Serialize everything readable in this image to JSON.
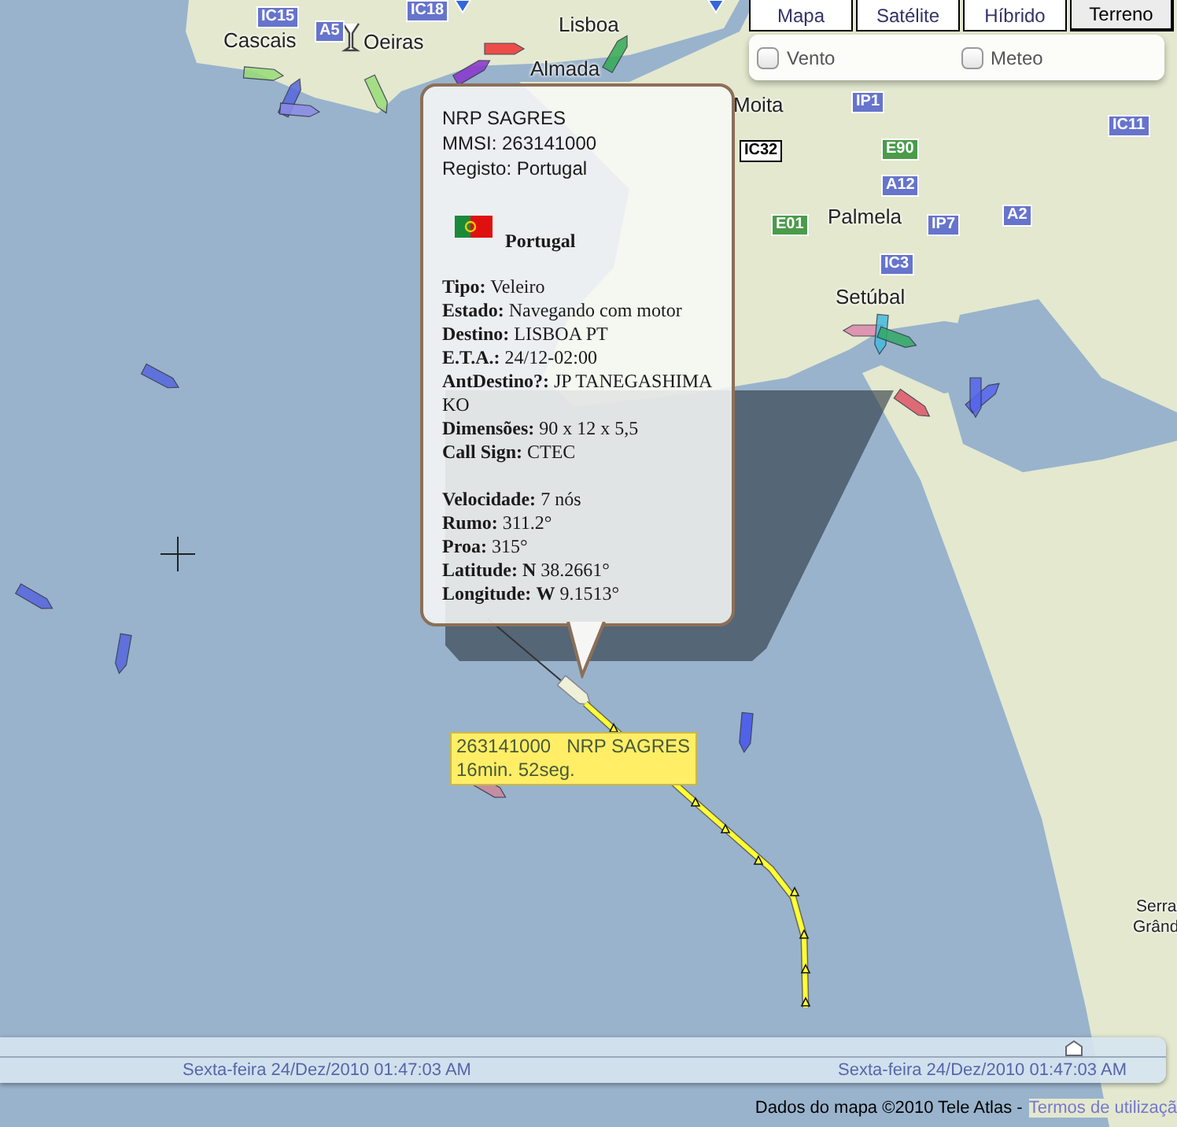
{
  "map_types": [
    {
      "label": "Mapa",
      "selected": false
    },
    {
      "label": "Satélite",
      "selected": false
    },
    {
      "label": "Híbrido",
      "selected": false
    },
    {
      "label": "Terreno",
      "selected": true
    }
  ],
  "overlays": [
    {
      "label": "Vento",
      "checked": false
    },
    {
      "label": "Meteo",
      "checked": false
    }
  ],
  "map_labels": [
    {
      "text": "IC15",
      "kind": "route"
    },
    {
      "text": "A5",
      "kind": "route"
    },
    {
      "text": "IC18",
      "kind": "route"
    },
    {
      "text": "Cascais",
      "kind": "place"
    },
    {
      "text": "Oeiras",
      "kind": "place"
    },
    {
      "text": "Lisboa",
      "kind": "place"
    },
    {
      "text": "Almada",
      "kind": "place"
    },
    {
      "text": "Moita",
      "kind": "place"
    },
    {
      "text": "IP1",
      "kind": "route"
    },
    {
      "text": "IC11",
      "kind": "route"
    },
    {
      "text": "IC32",
      "kind": "road"
    },
    {
      "text": "E90",
      "kind": "euroroute"
    },
    {
      "text": "A12",
      "kind": "route"
    },
    {
      "text": "E01",
      "kind": "euroroute"
    },
    {
      "text": "Palmela",
      "kind": "place"
    },
    {
      "text": "IP7",
      "kind": "route"
    },
    {
      "text": "A2",
      "kind": "route"
    },
    {
      "text": "IC3",
      "kind": "route"
    },
    {
      "text": "Setúbal",
      "kind": "place"
    },
    {
      "text": "Serra",
      "kind": "place"
    },
    {
      "text": "Grând",
      "kind": "place"
    }
  ],
  "popup": {
    "header": [
      "NRP SAGRES",
      "MMSI: 263141000",
      "Registo: Portugal"
    ],
    "flag_country": "Portugal",
    "details": [
      "**Tipo:** Veleiro",
      "**Estado:** Navegando com motor",
      "**Destino:** LISBOA PT",
      "**E.T.A.:** 24/12-02:00",
      "**AntDestino?:** JP TANEGASHIMA KO",
      "**Dimensões:** 90 x 12 x 5,5",
      "**Call Sign:** CTEC"
    ],
    "motion": [
      "**Velocidade:** 7 nós",
      "**Rumo:** 311.2°",
      "**Proa:** 315°",
      "**Latitude:** **N** 38.2661°",
      "**Longitude:** **W** 9.1513°"
    ]
  },
  "track_label": {
    "lines": [
      "263141000   NRP SAGRES",
      "16min. 52seg."
    ]
  },
  "timeline": {
    "level": 0.92,
    "start": "Sexta-feira 24/Dez/2010  01:47:03 AM",
    "end": "Sexta-feira 24/Dez/2010  01:47:03 AM"
  },
  "attribution": {
    "text": "Dados do mapa ©2010 Tele Atlas -",
    "link": "Termos de utilizaçã"
  }
}
